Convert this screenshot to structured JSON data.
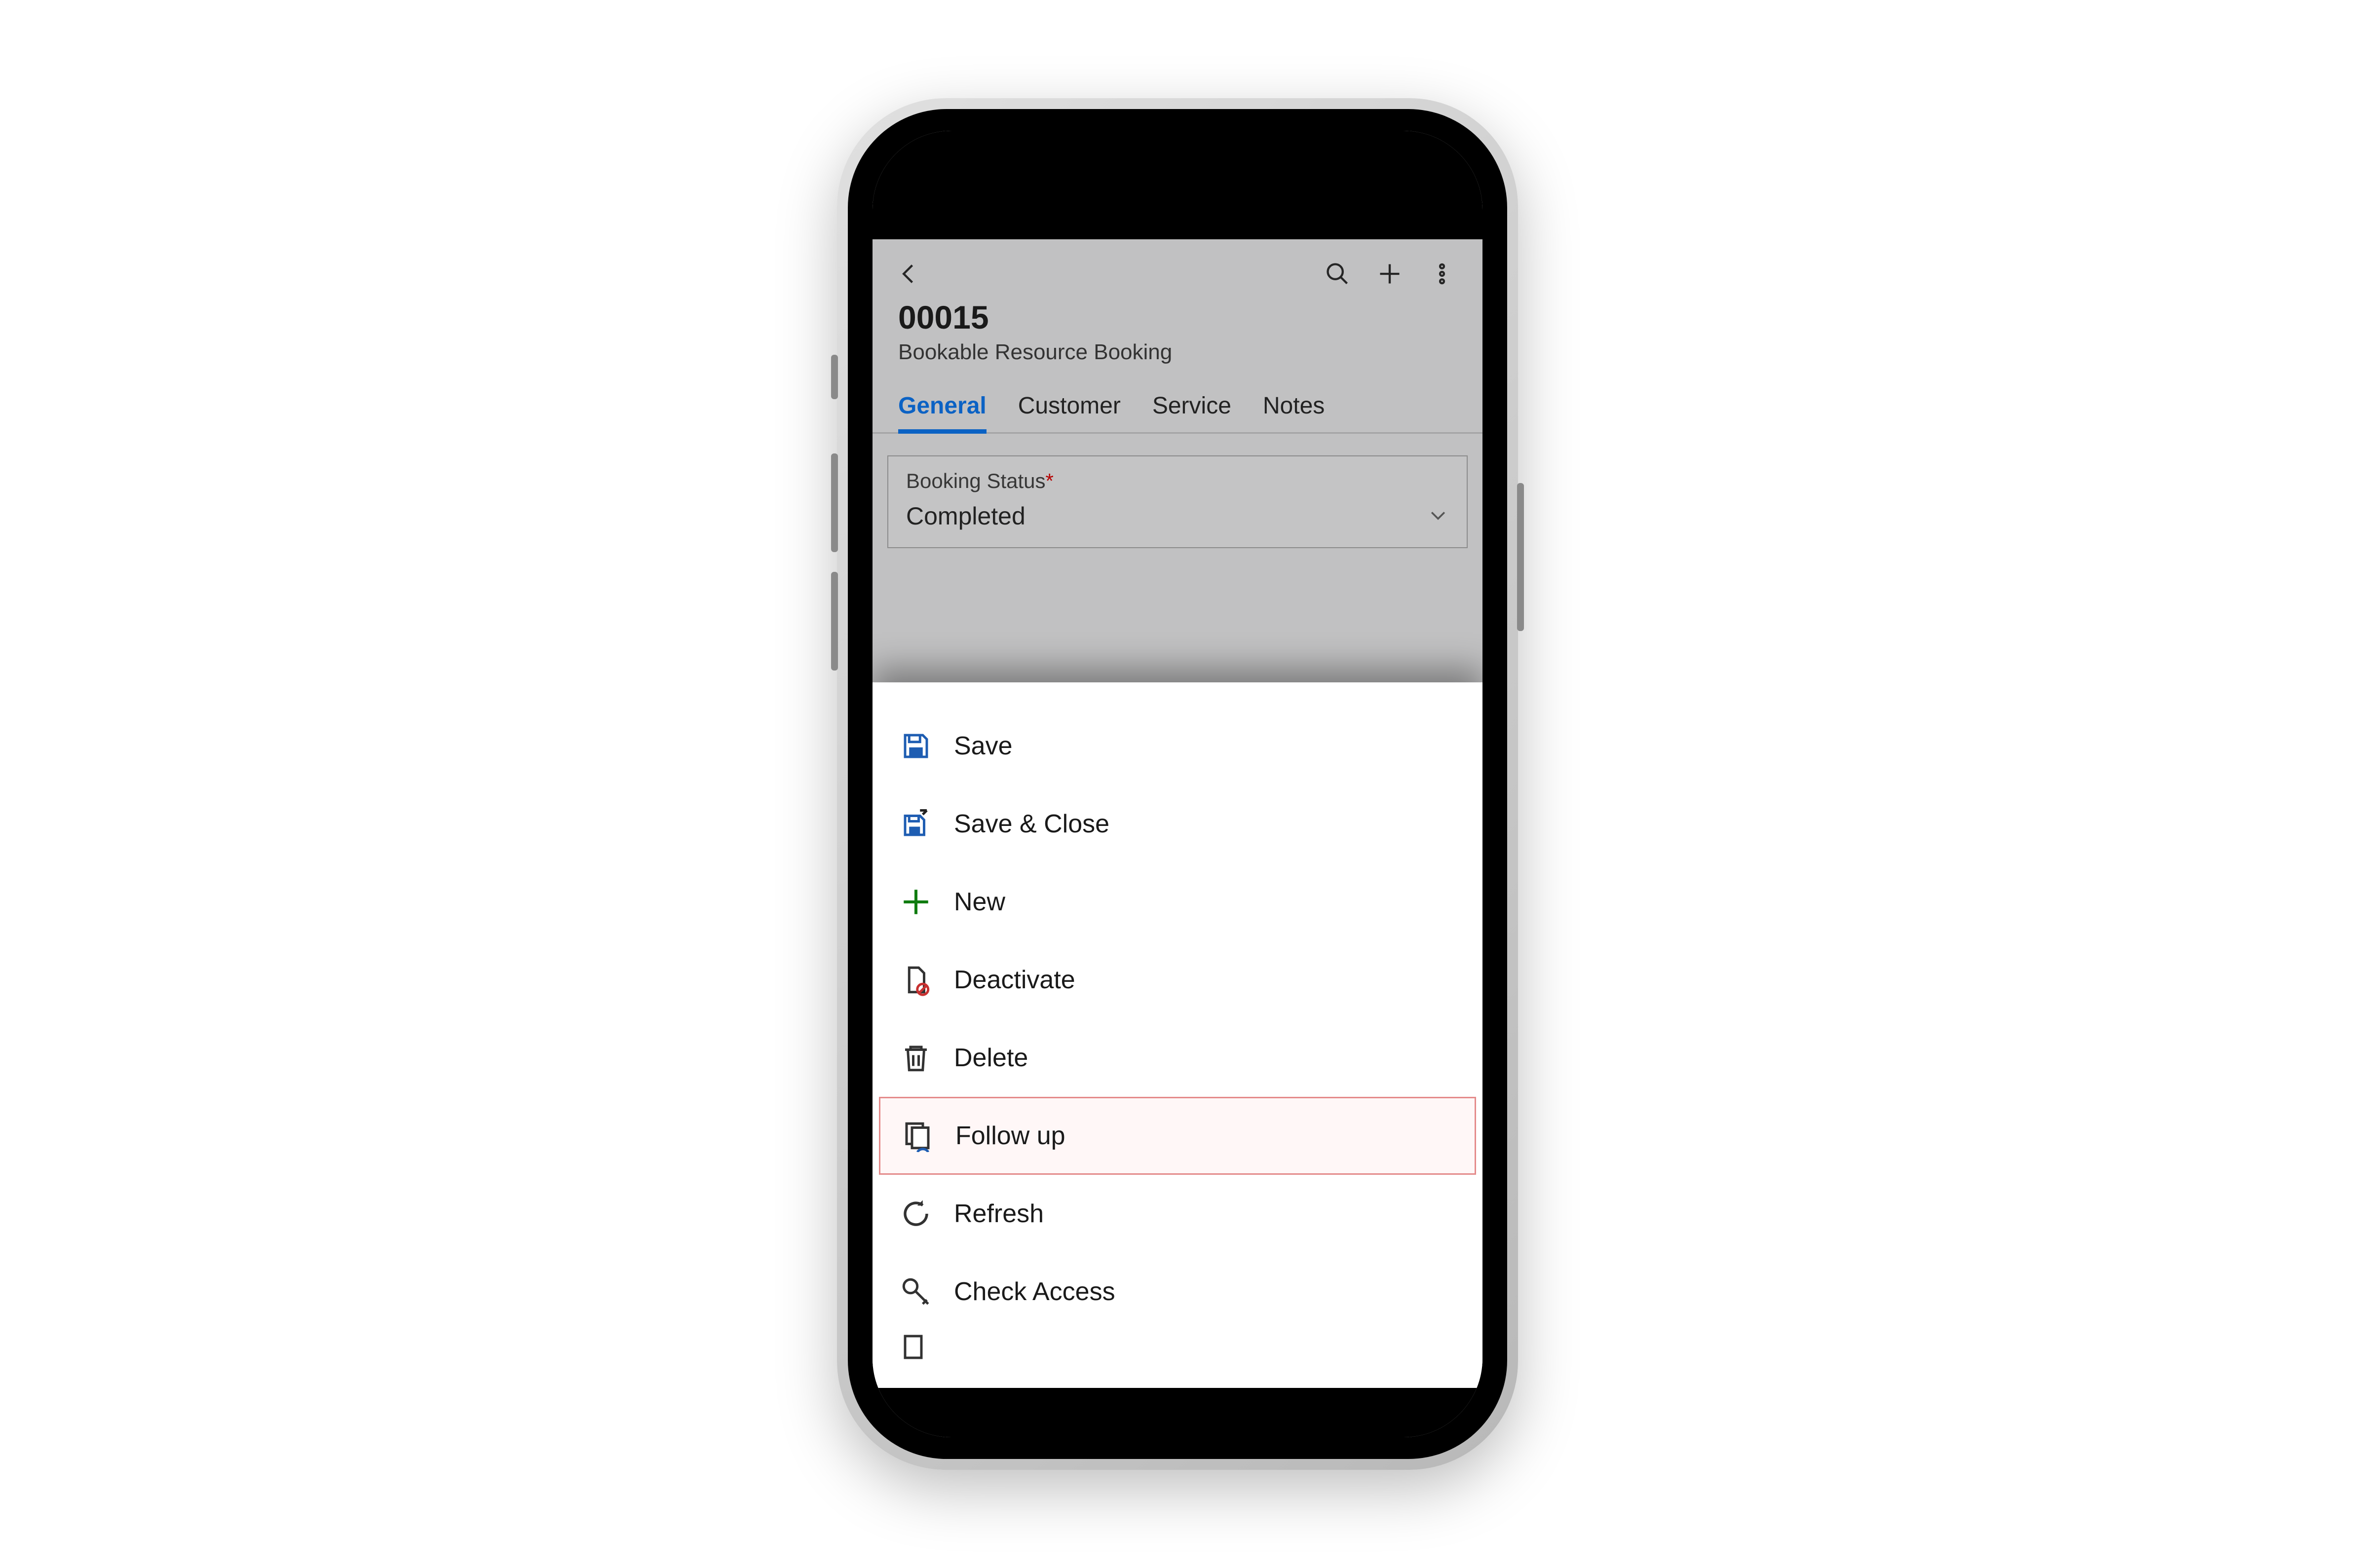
{
  "header": {
    "record_title": "00015",
    "record_subtitle": "Bookable Resource Booking"
  },
  "tabs": [
    {
      "label": "General",
      "active": true
    },
    {
      "label": "Customer",
      "active": false
    },
    {
      "label": "Service",
      "active": false
    },
    {
      "label": "Notes",
      "active": false
    }
  ],
  "field": {
    "label": "Booking Status",
    "required_mark": "*",
    "value": "Completed"
  },
  "menu": {
    "save": "Save",
    "save_close": "Save & Close",
    "new": "New",
    "deactivate": "Deactivate",
    "delete": "Delete",
    "follow_up": "Follow up",
    "refresh": "Refresh",
    "check_access": "Check Access"
  }
}
